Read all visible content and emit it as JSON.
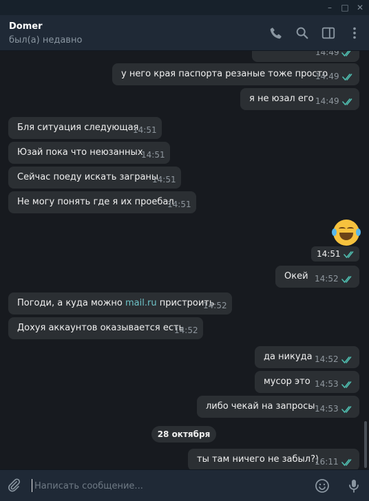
{
  "window": {
    "minimize": "–",
    "maximize": "□",
    "close": "✕"
  },
  "header": {
    "name": "Domer",
    "status": "был(а) недавно"
  },
  "icons": {
    "call": "phone-icon",
    "search": "search-icon",
    "panel": "sidebar-toggle-icon",
    "more": "more-vertical-icon",
    "attach": "paperclip-icon",
    "emoji": "smile-icon",
    "mic": "microphone-icon"
  },
  "colors": {
    "header_bg": "#1f2936",
    "chat_bg": "#171a1f",
    "bubble_bg": "#2b2f33",
    "read_tick": "#4fbcae",
    "link": "#6ec3c8"
  },
  "messages": [
    {
      "text": "у него края паспорта резаные тоже просто",
      "time": "14:49",
      "dir": "out",
      "read": true
    },
    {
      "text": "я не юзал его",
      "time": "14:49",
      "dir": "out",
      "read": true
    },
    {
      "text": "Бля ситуация следующая",
      "time": "14:51",
      "dir": "in"
    },
    {
      "text": "Юзай пока что неюзанных",
      "time": "14:51",
      "dir": "in"
    },
    {
      "text": "Сейчас поеду искать заграны",
      "time": "14:51",
      "dir": "in"
    },
    {
      "text": "Не могу понять где я их проебал",
      "time": "14:51",
      "dir": "in"
    },
    {
      "text": "",
      "time": "14:51",
      "dir": "out",
      "read": true,
      "sticker": "laughing-crying-emoji"
    },
    {
      "text": "Окей",
      "time": "14:52",
      "dir": "out",
      "read": true
    },
    {
      "text_before": "Погоди, а куда можно ",
      "link": "mail.ru",
      "text_after": " пристроить",
      "time": "14:52",
      "dir": "in"
    },
    {
      "text": "Дохуя аккаунтов оказывается есть",
      "time": "14:52",
      "dir": "in"
    },
    {
      "text": "да никуда",
      "time": "14:52",
      "dir": "out",
      "read": true
    },
    {
      "text": "мусор это",
      "time": "14:53",
      "dir": "out",
      "read": true
    },
    {
      "text": "либо чекай на запросы",
      "time": "14:53",
      "dir": "out",
      "read": true
    },
    {
      "text": "ты там ничего не забыл?)",
      "time": "16:11",
      "dir": "out",
      "read": true
    }
  ],
  "date_separator": "28 октября",
  "composer": {
    "placeholder": "Написать сообщение..."
  }
}
